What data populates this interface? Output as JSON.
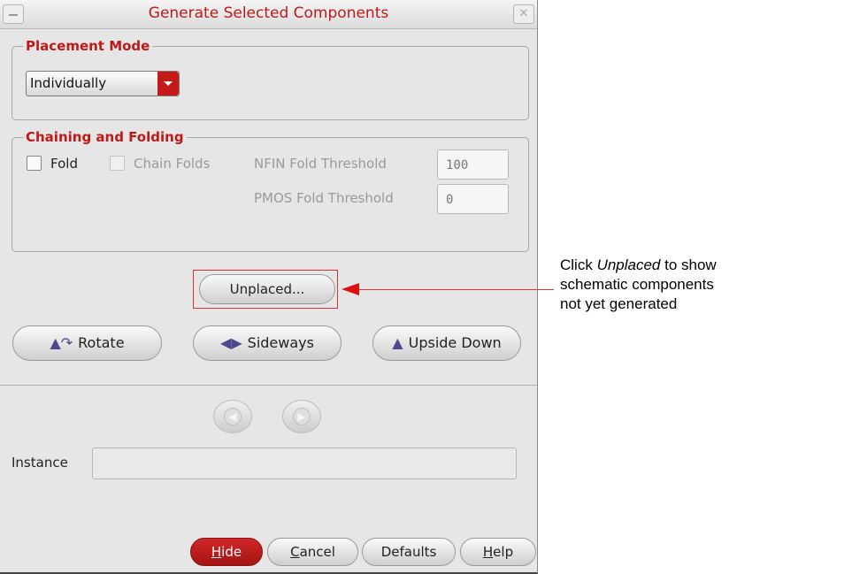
{
  "window": {
    "title": "Generate Selected Components",
    "minimize_icon": "minimize-icon",
    "close_icon": "close-icon",
    "close_glyph": "✕"
  },
  "placement_mode": {
    "group_title": "Placement Mode",
    "selected": "Individually"
  },
  "chaining": {
    "group_title": "Chaining and Folding",
    "fold_label": "Fold",
    "fold_checked": false,
    "chain_folds_label": "Chain Folds",
    "chain_folds_checked": false,
    "nfin_label": "NFIN Fold Threshold",
    "nfin_value": "100",
    "pmos_label": "PMOS Fold Threshold",
    "pmos_value": "0"
  },
  "actions": {
    "unplaced": "Unplaced...",
    "rotate": "Rotate",
    "sideways": "Sideways",
    "upside_down": "Upside Down"
  },
  "icons": {
    "rotate": "rotate-icon",
    "sideways": "sideways-icon",
    "upside_down": "upside-down-icon",
    "prev": "previous-icon",
    "next": "next-icon"
  },
  "instance": {
    "label": "Instance",
    "value": ""
  },
  "footer": {
    "hide_prefix": "H",
    "hide_rest": "ide",
    "cancel_prefix": "C",
    "cancel_rest": "ancel",
    "defaults": "Defaults",
    "help_prefix": "H",
    "help_rest": "elp"
  },
  "callout": {
    "prefix": "Click ",
    "emph": "Unplaced",
    "line1_rest": " to show",
    "line2": "schematic components",
    "line3": "not yet generated"
  },
  "colors": {
    "accent": "#c01818",
    "callout_arrow": "#e01010",
    "dialog_bg": "#e6e6e6"
  }
}
